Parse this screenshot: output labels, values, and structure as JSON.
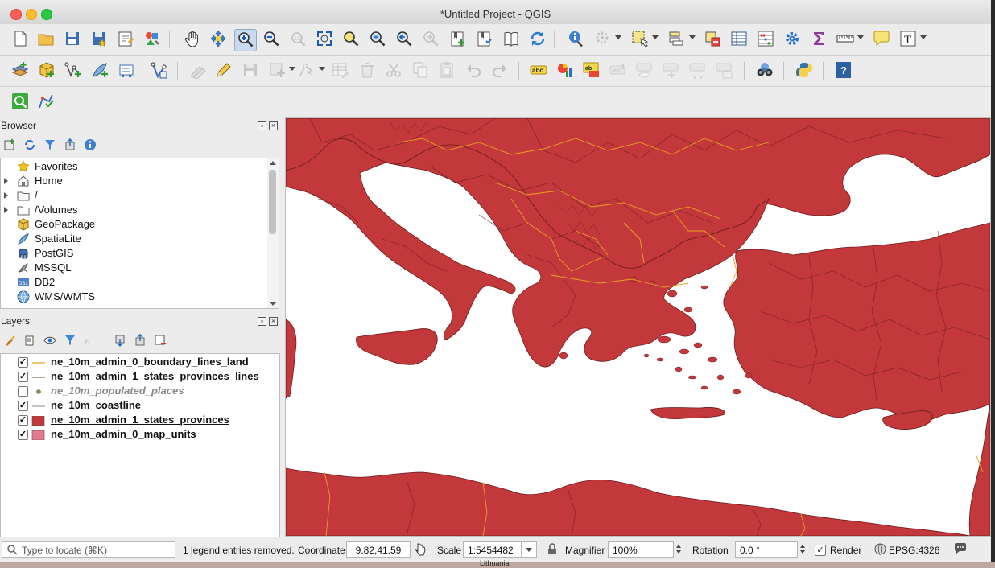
{
  "window": {
    "title": "*Untitled Project - QGIS"
  },
  "toolbar1": {
    "buttons": [
      {
        "name": "new-project",
        "icon": "file-icon"
      },
      {
        "name": "open-project",
        "icon": "folder-icon"
      },
      {
        "name": "save-project",
        "icon": "floppy-icon"
      },
      {
        "name": "save-as",
        "icon": "floppy-star-icon"
      },
      {
        "name": "print-layout",
        "icon": "layout-icon"
      },
      {
        "name": "style-manager",
        "icon": "style-icon"
      },
      {
        "name": "pan",
        "icon": "hand-icon"
      },
      {
        "name": "pan-to-selection",
        "icon": "pan-selection-icon"
      },
      {
        "name": "zoom-in",
        "icon": "zoom-in-icon",
        "active": true
      },
      {
        "name": "zoom-out",
        "icon": "zoom-out-icon"
      },
      {
        "name": "zoom-native",
        "icon": "zoom-native-icon",
        "disabled": true
      },
      {
        "name": "zoom-full",
        "icon": "zoom-full-icon"
      },
      {
        "name": "zoom-selection",
        "icon": "zoom-selection-icon"
      },
      {
        "name": "zoom-layer",
        "icon": "zoom-layer-icon"
      },
      {
        "name": "zoom-last",
        "icon": "zoom-last-icon"
      },
      {
        "name": "zoom-next",
        "icon": "zoom-next-icon",
        "disabled": true
      },
      {
        "name": "new-bookmark",
        "icon": "bookmark-new-icon"
      },
      {
        "name": "show-bookmarks",
        "icon": "bookmark-icon"
      },
      {
        "name": "spatial-bookmarks",
        "icon": "book-icon"
      },
      {
        "name": "refresh",
        "icon": "refresh-icon"
      },
      {
        "name": "identify",
        "icon": "info-icon"
      },
      {
        "name": "action",
        "icon": "gear-action-icon",
        "disabled": true
      },
      {
        "name": "select-features",
        "icon": "select-rect-icon"
      },
      {
        "name": "select-by-value",
        "icon": "select-value-icon"
      },
      {
        "name": "deselect",
        "icon": "deselect-icon"
      },
      {
        "name": "attribute-table",
        "icon": "table-icon"
      },
      {
        "name": "field-calculator",
        "icon": "abacus-icon"
      },
      {
        "name": "processing-toolbox",
        "icon": "gear-blue-icon"
      },
      {
        "name": "statistical-summary",
        "icon": "sigma-icon"
      },
      {
        "name": "measure",
        "icon": "ruler-icon"
      },
      {
        "name": "map-tips",
        "icon": "speech-bubble-icon"
      },
      {
        "name": "text-annotation",
        "icon": "text-annotation-icon"
      }
    ]
  },
  "toolbar2": {
    "buttons": [
      {
        "name": "data-source-manager",
        "icon": "layers-add-icon"
      },
      {
        "name": "new-geopackage",
        "icon": "geopackage-new-icon"
      },
      {
        "name": "new-shapefile",
        "icon": "vector-new-icon"
      },
      {
        "name": "new-spatialite",
        "icon": "spatialite-new-icon"
      },
      {
        "name": "new-virtual-layer",
        "icon": "virtual-layer-icon"
      },
      {
        "name": "add-vector",
        "icon": "vector-add-icon"
      },
      {
        "name": "current-edits",
        "icon": "pencil-multi-icon",
        "disabled": true
      },
      {
        "name": "toggle-editing",
        "icon": "pencil-icon"
      },
      {
        "name": "save-edits",
        "icon": "floppy-gray-icon",
        "disabled": true
      },
      {
        "name": "add-feature",
        "icon": "add-feature-icon",
        "disabled": true
      },
      {
        "name": "vertex-tool",
        "icon": "vertex-icon",
        "disabled": true
      },
      {
        "name": "modify-attributes",
        "icon": "edit-table-icon",
        "disabled": true
      },
      {
        "name": "delete-selected",
        "icon": "trash-icon",
        "disabled": true
      },
      {
        "name": "cut-features",
        "icon": "scissors-icon",
        "disabled": true
      },
      {
        "name": "copy-features",
        "icon": "copy-icon",
        "disabled": true
      },
      {
        "name": "paste-features",
        "icon": "paste-icon",
        "disabled": true
      },
      {
        "name": "undo",
        "icon": "undo-icon",
        "disabled": true
      },
      {
        "name": "redo",
        "icon": "redo-icon",
        "disabled": true
      },
      {
        "name": "layer-labeling",
        "icon": "label-abc-icon"
      },
      {
        "name": "layer-diagram",
        "icon": "diagram-icon"
      },
      {
        "name": "highlight-pinned-labels",
        "icon": "label-highlight-icon"
      },
      {
        "name": "pin-labels",
        "icon": "label-pin-icon",
        "disabled": true
      },
      {
        "name": "show-hide-labels",
        "icon": "label-eye-icon",
        "disabled": true
      },
      {
        "name": "move-label",
        "icon": "label-move-icon",
        "disabled": true
      },
      {
        "name": "rotate-label",
        "icon": "label-rotate-icon",
        "disabled": true
      },
      {
        "name": "change-label",
        "icon": "label-change-icon",
        "disabled": true
      },
      {
        "name": "plugin-metasearch",
        "icon": "binoculars-icon"
      },
      {
        "name": "python-console",
        "icon": "python-icon"
      },
      {
        "name": "help",
        "icon": "help-icon"
      }
    ]
  },
  "toolbar3": {
    "buttons": [
      {
        "name": "locator-search",
        "icon": "green-search-icon"
      },
      {
        "name": "geometry-checker",
        "icon": "geometry-check-icon"
      }
    ]
  },
  "browser": {
    "title": "Browser",
    "items": [
      {
        "label": "Favorites",
        "icon": "star-icon",
        "expandable": false
      },
      {
        "label": "Home",
        "icon": "home-icon",
        "expandable": true
      },
      {
        "label": "/",
        "icon": "folder-icon",
        "expandable": true
      },
      {
        "label": "/Volumes",
        "icon": "folder-icon",
        "expandable": true
      },
      {
        "label": "GeoPackage",
        "icon": "geopackage-icon",
        "expandable": false
      },
      {
        "label": "SpatiaLite",
        "icon": "spatialite-icon",
        "expandable": false
      },
      {
        "label": "PostGIS",
        "icon": "postgis-elephant-icon",
        "expandable": false
      },
      {
        "label": "MSSQL",
        "icon": "mssql-icon",
        "expandable": false
      },
      {
        "label": "DB2",
        "icon": "db2-icon",
        "expandable": false
      },
      {
        "label": "WMS/WMTS",
        "icon": "globe-icon",
        "expandable": false
      }
    ]
  },
  "layers": {
    "title": "Layers",
    "items": [
      {
        "label": "ne_10m_admin_0_boundary_lines_land",
        "checked": true,
        "symbol": "line",
        "color": "#e8b436"
      },
      {
        "label": "ne_10m_admin_1_states_provinces_lines",
        "checked": true,
        "symbol": "line",
        "color": "#9c8b6e"
      },
      {
        "label": "ne_10m_populated_places",
        "checked": false,
        "symbol": "point",
        "color": "#7a9a3a"
      },
      {
        "label": "ne_10m_coastline",
        "checked": true,
        "symbol": "line",
        "color": "#b0b0b0"
      },
      {
        "label": "ne_10m_admin_1_states_provinces",
        "checked": true,
        "symbol": "fill",
        "color": "#c3393b"
      },
      {
        "label": "ne_10m_admin_0_map_units",
        "checked": true,
        "symbol": "fill",
        "color": "#e67890"
      }
    ]
  },
  "map": {
    "fill_color": "#c3393b",
    "line_color": "#6e1a1c",
    "border_color": "#e8a020",
    "sea_color": "#ffffff"
  },
  "statusbar": {
    "locate_placeholder": "Type to locate (⌘K)",
    "message": "1 legend entries removed.",
    "coordinate_label": "Coordinate",
    "coordinate_value": "9.82,41.59",
    "scale_label": "Scale",
    "scale_value": "1:5454482",
    "magnifier_label": "Magnifier",
    "magnifier_value": "100%",
    "rotation_label": "Rotation",
    "rotation_value": "0.0 °",
    "render_label": "Render",
    "render_checked": true,
    "crs": "EPSG:4326"
  },
  "background_strip": {
    "text": "Lithuania"
  }
}
